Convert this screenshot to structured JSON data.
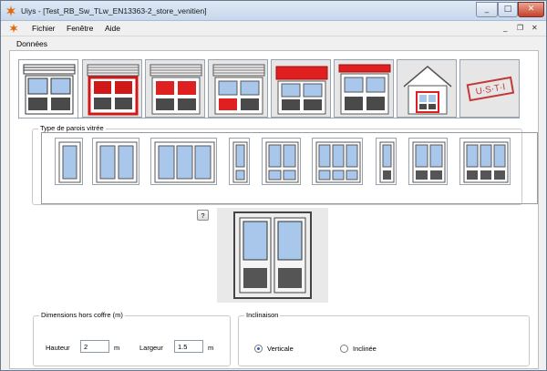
{
  "window": {
    "title": "Uiys - [Test_RB_Sw_TLw_EN13363-2_store_venitien]",
    "controls": {
      "minimize": "_",
      "maximize": "□",
      "close": "✕"
    }
  },
  "menu": {
    "items": [
      {
        "label": "Fichier"
      },
      {
        "label": "Fenêtre"
      },
      {
        "label": "Aide"
      }
    ],
    "mdi_controls": {
      "minimize": "_",
      "restore": "❐",
      "close": "✕"
    }
  },
  "toolbar": {
    "label": "Données"
  },
  "tabs": [
    {
      "name": "venetian-blind"
    },
    {
      "name": "roller-shutter-red-frame"
    },
    {
      "name": "roller-shutter-red-panes"
    },
    {
      "name": "roller-shutter-red-side"
    },
    {
      "name": "awning-red"
    },
    {
      "name": "red-slat-top"
    },
    {
      "name": "house"
    },
    {
      "name": "usti-stamp",
      "stamp_text": "U·S·T·I"
    }
  ],
  "glazing": {
    "group_label": "Type de parois vitrée",
    "types": [
      {
        "name": "single"
      },
      {
        "name": "double"
      },
      {
        "name": "triple"
      },
      {
        "name": "single-split"
      },
      {
        "name": "double-split"
      },
      {
        "name": "triple-split"
      },
      {
        "name": "single-panel"
      },
      {
        "name": "double-panel"
      },
      {
        "name": "triple-panel"
      }
    ]
  },
  "help": {
    "label": "?"
  },
  "dimensions": {
    "group_label": "Dimensions hors coffre (m)",
    "height_label": "Hauteur",
    "height_value": "2",
    "height_unit": "m",
    "width_label": "Largeur",
    "width_value": "1.5",
    "width_unit": "m"
  },
  "inclination": {
    "group_label": "Inclinaison",
    "options": [
      {
        "label": "Verticale",
        "selected": true
      },
      {
        "label": "Inclinée",
        "selected": false
      }
    ]
  },
  "colors": {
    "accent_red": "#e02020",
    "glass_blue": "#a9c7ea",
    "panel_grey": "#5a5a5a",
    "frame_grey": "#9aa3b0"
  }
}
